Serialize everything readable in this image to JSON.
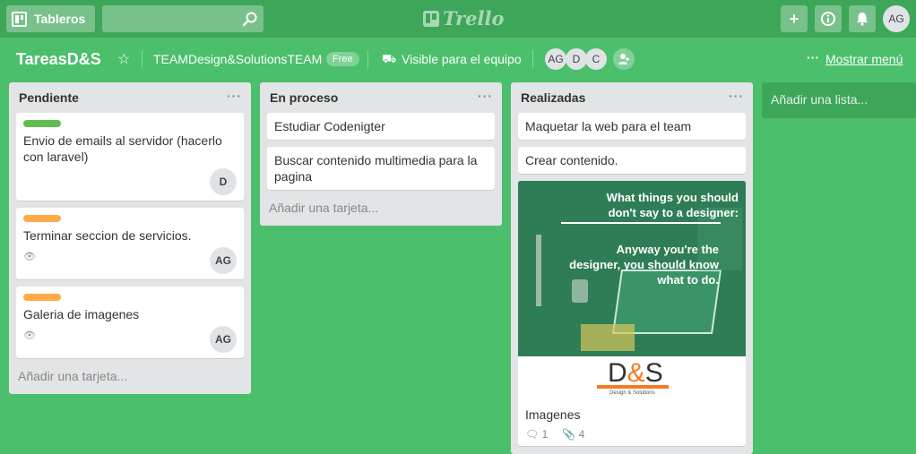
{
  "header": {
    "boards_label": "Tableros",
    "search_value": "",
    "logo_text": "Trello",
    "add_label": "+",
    "info_label": "i",
    "user_initials": "AG"
  },
  "board": {
    "title": "TareasD&S",
    "team": "TEAMDesign&SolutionsTEAM",
    "plan_badge": "Free",
    "visibility": "Visible para el equipo",
    "members": [
      "AG",
      "D",
      "C"
    ],
    "show_menu": "Mostrar menú"
  },
  "colors": {
    "label_green": "#61bd4f",
    "label_orange": "#ffab4a",
    "board_bg": "#4bbf6b"
  },
  "lists": [
    {
      "title": "Pendiente",
      "cards": [
        {
          "title": "Envio de emails al servidor (hacerlo con laravel)",
          "label": "green",
          "member": "D"
        },
        {
          "title": "Terminar seccion de servicios.",
          "label": "orange",
          "member": "AG",
          "watched": true
        },
        {
          "title": "Galeria de imagenes",
          "label": "orange",
          "member": "AG",
          "watched": true
        }
      ],
      "add_card": "Añadir una tarjeta..."
    },
    {
      "title": "En proceso",
      "cards": [
        {
          "title": "Estudiar Codenigter"
        },
        {
          "title": "Buscar contenido multimedia para la pagina"
        }
      ],
      "add_card": "Añadir una tarjeta..."
    },
    {
      "title": "Realizadas",
      "cards": [
        {
          "title": "Maquetar la web para el team"
        },
        {
          "title": "Crear contenido."
        },
        {
          "title": "Imagenes",
          "cover": {
            "line1": "What things you should",
            "line2": "don't say to a designer:",
            "line3": "Anyway you're the",
            "line4": "designer, you should know",
            "line5": "what to do.",
            "logo_d": "D",
            "logo_amp": "&",
            "logo_s": "S",
            "logo_sub": "Design & Solutions"
          },
          "comments": "1",
          "attachments": "4"
        }
      ]
    }
  ],
  "add_list": "Añadir una lista..."
}
